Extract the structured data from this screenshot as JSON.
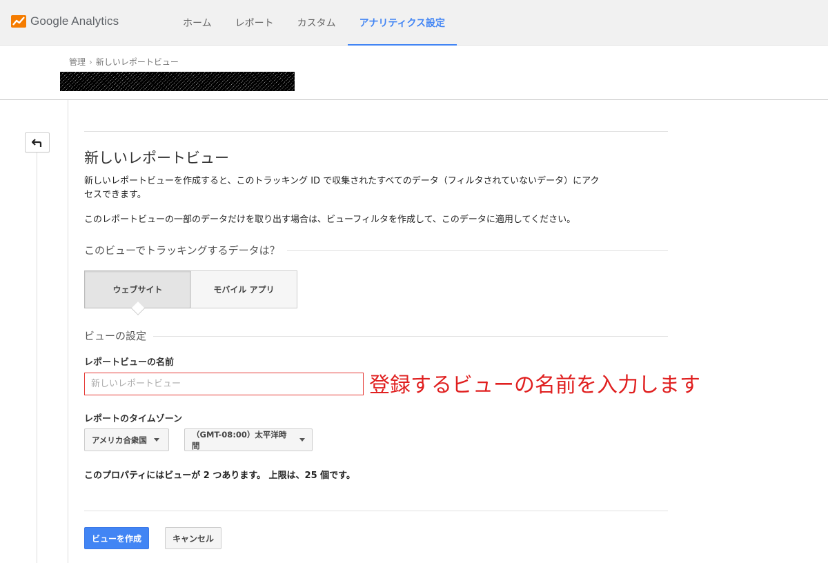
{
  "app": {
    "logo_text": "Google Analytics"
  },
  "nav": {
    "tabs": [
      {
        "label": "ホーム"
      },
      {
        "label": "レポート"
      },
      {
        "label": "カスタム"
      },
      {
        "label": "アナリティクス設定",
        "active": true
      }
    ]
  },
  "breadcrumb": {
    "root": "管理",
    "current": "新しいレポートビュー"
  },
  "page": {
    "title": "新しいレポートビュー",
    "intro_line1": "新しいレポートビューを作成すると、このトラッキング ID で収集されたすべてのデータ（フィルタされていないデータ）にアク",
    "intro_line2": "セスできます。",
    "filter_note": "このレポートビューの一部のデータだけを取り出す場合は、ビューフィルタを作成して、このデータに適用してください。"
  },
  "tracking": {
    "section_title": "このビューでトラッキングするデータは？",
    "options": [
      "ウェブサイト",
      "モバイル アプリ"
    ],
    "selected": "ウェブサイト"
  },
  "view_settings": {
    "section_title": "ビューの設定",
    "name_label": "レポートビューの名前",
    "name_placeholder": "新しいレポートビュー",
    "annotation": "登録するビューの名前を入力します",
    "timezone_label": "レポートのタイムゾーン",
    "country_value": "アメリカ合衆国",
    "timezone_value": "（GMT-08:00）太平洋時間"
  },
  "limit_text": "このプロパティにはビューが 2 つあります。 上限は、25 個です。",
  "actions": {
    "create_label": "ビューを作成",
    "cancel_label": "キャンセル"
  },
  "colors": {
    "accent": "#4285f4",
    "annotation": "#e02020"
  }
}
